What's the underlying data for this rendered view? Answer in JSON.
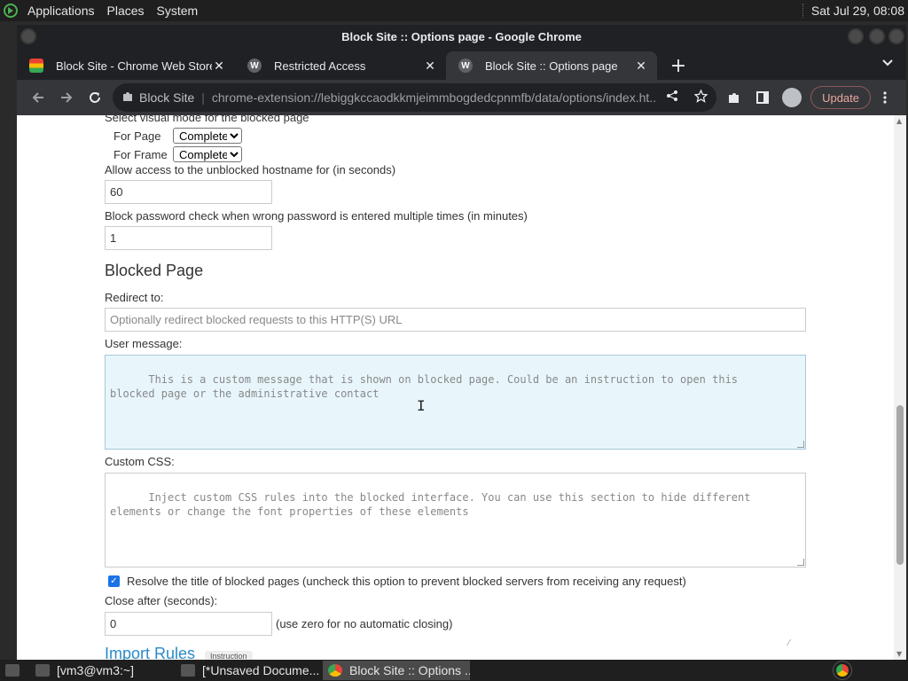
{
  "system_panel": {
    "menus": [
      "Applications",
      "Places",
      "System"
    ],
    "clock": "Sat Jul 29, 08:08"
  },
  "window": {
    "title": "Block Site :: Options page - Google Chrome"
  },
  "tabs": [
    {
      "title": "Block Site - Chrome Web Store",
      "favicon": "chrome-web-store-icon",
      "active": false
    },
    {
      "title": "Restricted Access",
      "favicon": "w-icon",
      "active": false
    },
    {
      "title": "Block Site :: Options page",
      "favicon": "w-icon",
      "active": true
    }
  ],
  "toolbar": {
    "site_name": "Block Site",
    "url": "chrome-extension://lebiggkccaodkkmjeimmbogdedcpnmfb/data/options/index.ht...",
    "update_label": "Update"
  },
  "page": {
    "visual_mode_label": "Select visual mode for the blocked page",
    "for_page_label": "For Page",
    "for_page_value": "Complete",
    "for_frame_label": "For Frame",
    "for_frame_value": "Complete",
    "allow_access_label": "Allow access to the unblocked hostname for (in seconds)",
    "allow_access_value": "60",
    "password_check_label": "Block password check when wrong password is entered multiple times (in minutes)",
    "password_check_value": "1",
    "blocked_page_heading": "Blocked Page",
    "redirect_label": "Redirect to:",
    "redirect_placeholder": "Optionally redirect blocked requests to this HTTP(S) URL",
    "user_message_label": "User message:",
    "user_message_placeholder": "This is a custom message that is shown on blocked page. Could be an instruction to open this\nblocked page or the administrative contact",
    "custom_css_label": "Custom CSS:",
    "custom_css_placeholder": "Inject custom CSS rules into the blocked interface. You can use this section to hide different\nelements or change the font properties of these elements",
    "resolve_title_label": "Resolve the title of blocked pages (uncheck this option to prevent blocked servers from receiving any request)",
    "resolve_title_checked": true,
    "close_after_label": "Close after (seconds):",
    "close_after_value": "0",
    "close_after_hint": "(use zero for no automatic closing)",
    "import_rules_heading": "Import Rules",
    "instruction_label": "Instruction"
  },
  "taskbar": {
    "tasks": [
      {
        "label": "[vm3@vm3:~]",
        "icon": "terminal-icon",
        "active": false
      },
      {
        "label": "[*Unsaved Docume...",
        "icon": "text-editor-icon",
        "active": false
      },
      {
        "label": "Block Site :: Options ...",
        "icon": "chrome-icon",
        "active": true
      }
    ]
  }
}
